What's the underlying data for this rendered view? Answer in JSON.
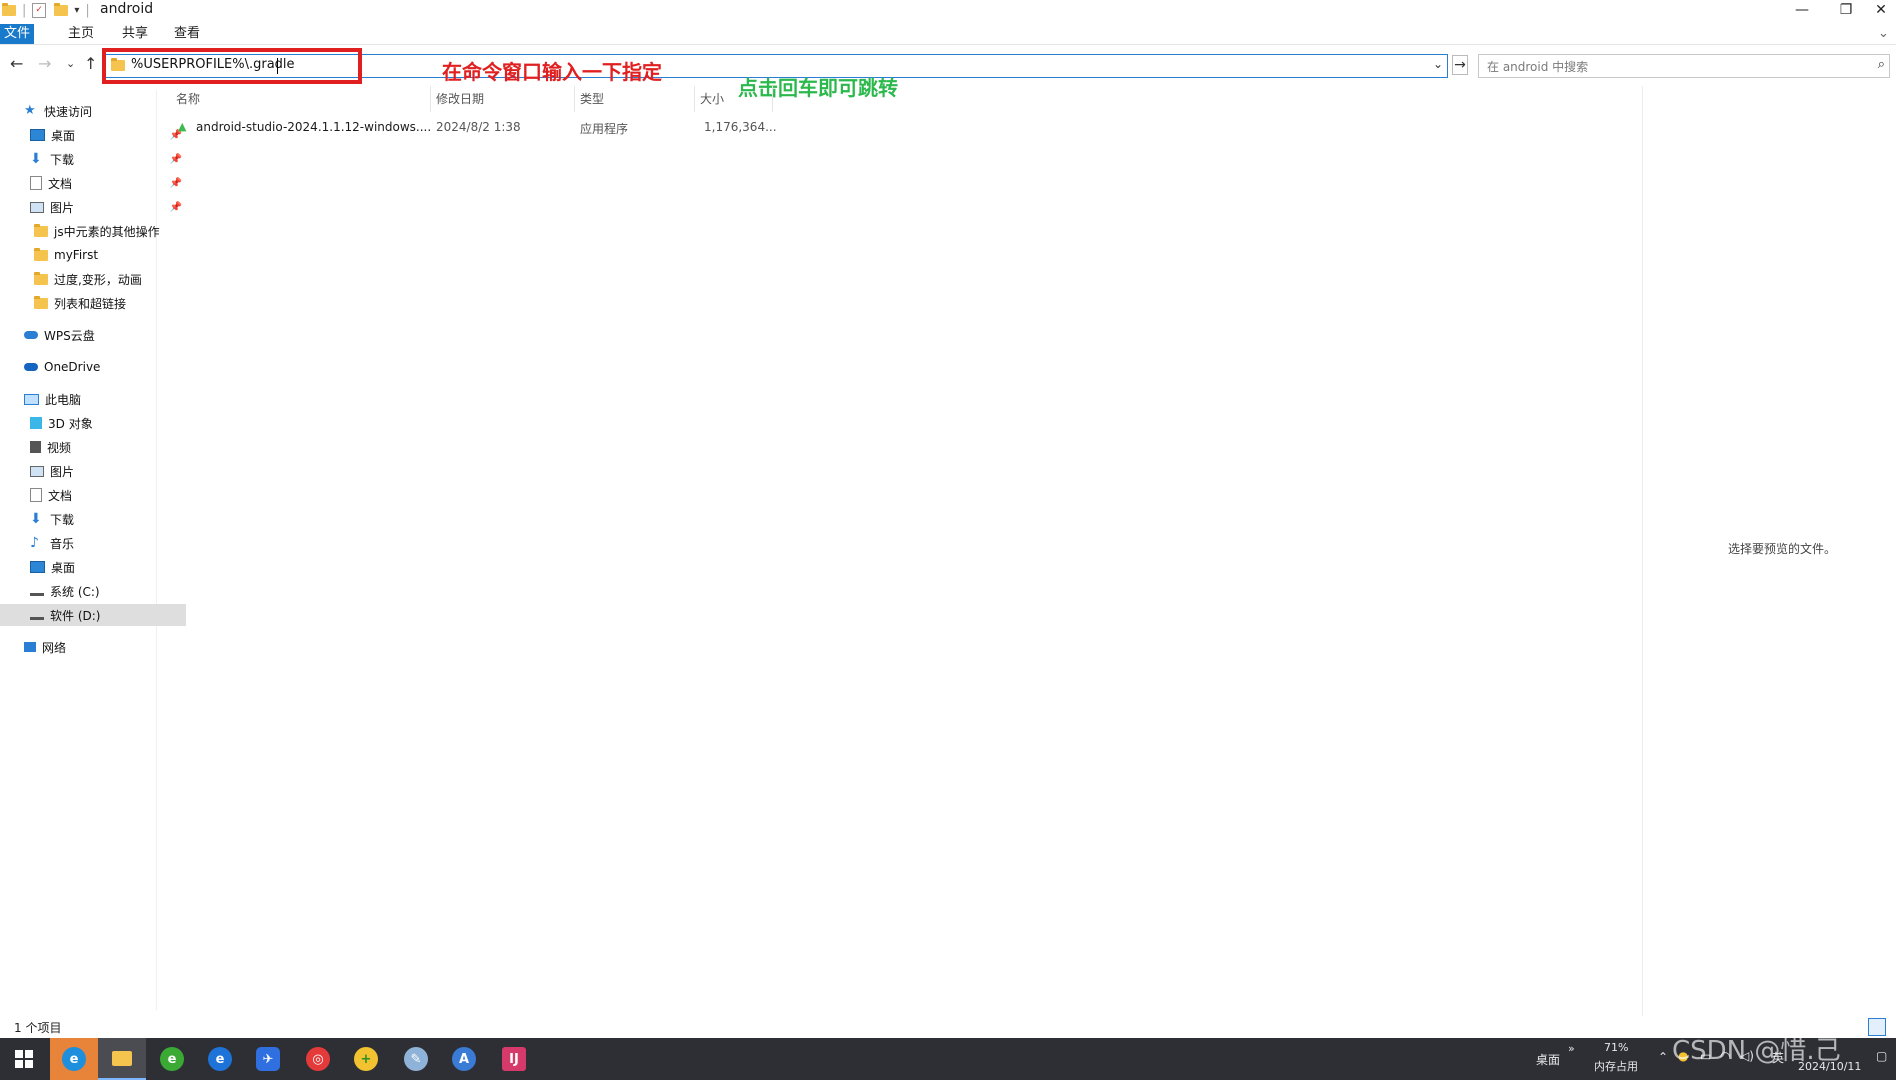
{
  "window": {
    "title": "android",
    "minimize": "—",
    "restore": "❐",
    "close": "✕"
  },
  "ribbon": {
    "tabs": [
      "文件",
      "主页",
      "共享",
      "查看"
    ],
    "expand": "⌄"
  },
  "nav": {
    "back": "←",
    "forward": "→",
    "recent": "⌄",
    "up": "↑",
    "address_value": "%USERPROFILE%\\.gradle",
    "address_dropdown": "⌄",
    "go": "→",
    "search_placeholder": "在 android 中搜索",
    "search_icon": "⌕"
  },
  "annotations": {
    "red": "在命令窗口输入一下指定",
    "green": "点击回车即可跳转"
  },
  "sidebar": {
    "quick_access": "快速访问",
    "pinned": [
      {
        "label": "桌面",
        "icon": "desktop-icon"
      },
      {
        "label": "下载",
        "icon": "download-icon"
      },
      {
        "label": "文档",
        "icon": "document-icon"
      },
      {
        "label": "图片",
        "icon": "picture-icon"
      }
    ],
    "folders": [
      "js中元素的其他操作",
      "myFirst",
      "过度,变形，动画",
      "列表和超链接"
    ],
    "wps": "WPS云盘",
    "onedrive": "OneDrive",
    "this_pc": "此电脑",
    "pc_items": [
      "3D 对象",
      "视频",
      "图片",
      "文档",
      "下载",
      "音乐",
      "桌面",
      "系统 (C:)",
      "软件 (D:)"
    ],
    "network": "网络"
  },
  "columns": {
    "name": "名称",
    "date": "修改日期",
    "type": "类型",
    "size": "大小"
  },
  "files": [
    {
      "name": "android-studio-2024.1.1.12-windows....",
      "date": "2024/8/2 1:38",
      "type": "应用程序",
      "size": "1,176,364..."
    }
  ],
  "preview": {
    "message": "选择要预览的文件。"
  },
  "status": {
    "count": "1 个项目"
  },
  "taskbar": {
    "desktop_label": "桌面",
    "chevron": "»",
    "memory_percent": "71%",
    "memory_label": "内存占用",
    "ime": "英",
    "date": "2024/10/11",
    "watermark": "CSDN @惜.己"
  }
}
